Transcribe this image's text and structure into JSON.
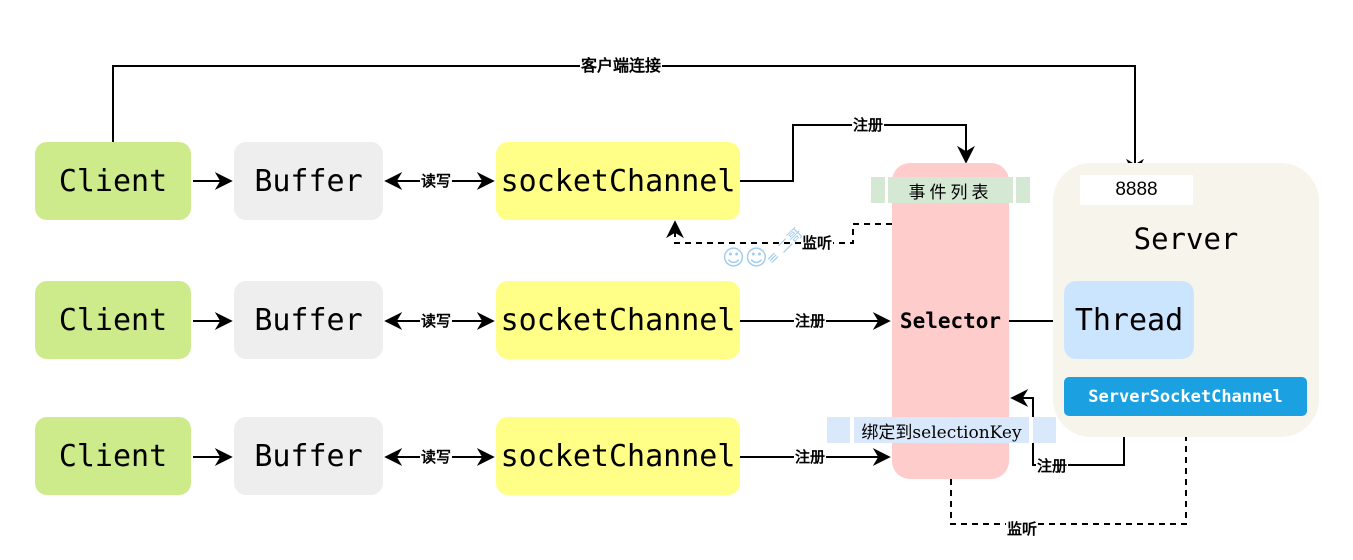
{
  "diagram": {
    "top_connection_label": "客户端连接",
    "rows": [
      {
        "client": "Client",
        "buffer": "Buffer",
        "rw_label": "读写",
        "channel": "socketChannel",
        "register_label": "注册"
      },
      {
        "client": "Client",
        "buffer": "Buffer",
        "rw_label": "读写",
        "channel": "socketChannel",
        "register_label": "注册"
      },
      {
        "client": "Client",
        "buffer": "Buffer",
        "rw_label": "读写",
        "channel": "socketChannel",
        "register_label": "注册"
      }
    ],
    "listen_label_top": "监听",
    "selector": {
      "label": "Selector",
      "event_list_label": "事件列表",
      "bind_key_label": "绑定到selectionKey"
    },
    "server": {
      "title": "Server",
      "port": "8888",
      "thread_label": "Thread",
      "server_socket_channel_label": "ServerSocketChannel",
      "register_label": "注册",
      "listen_label": "监听"
    },
    "colors": {
      "client": "#cdeb8b",
      "buffer": "#eeeeee",
      "channel": "#ffff88",
      "selector": "#ffcccc",
      "event_list": "#d5e8d4",
      "bind_key": "#dae8fc",
      "server": "#f7f4ec",
      "thread": "#cce5ff",
      "server_socket_channel": "#1ba1e2"
    }
  }
}
